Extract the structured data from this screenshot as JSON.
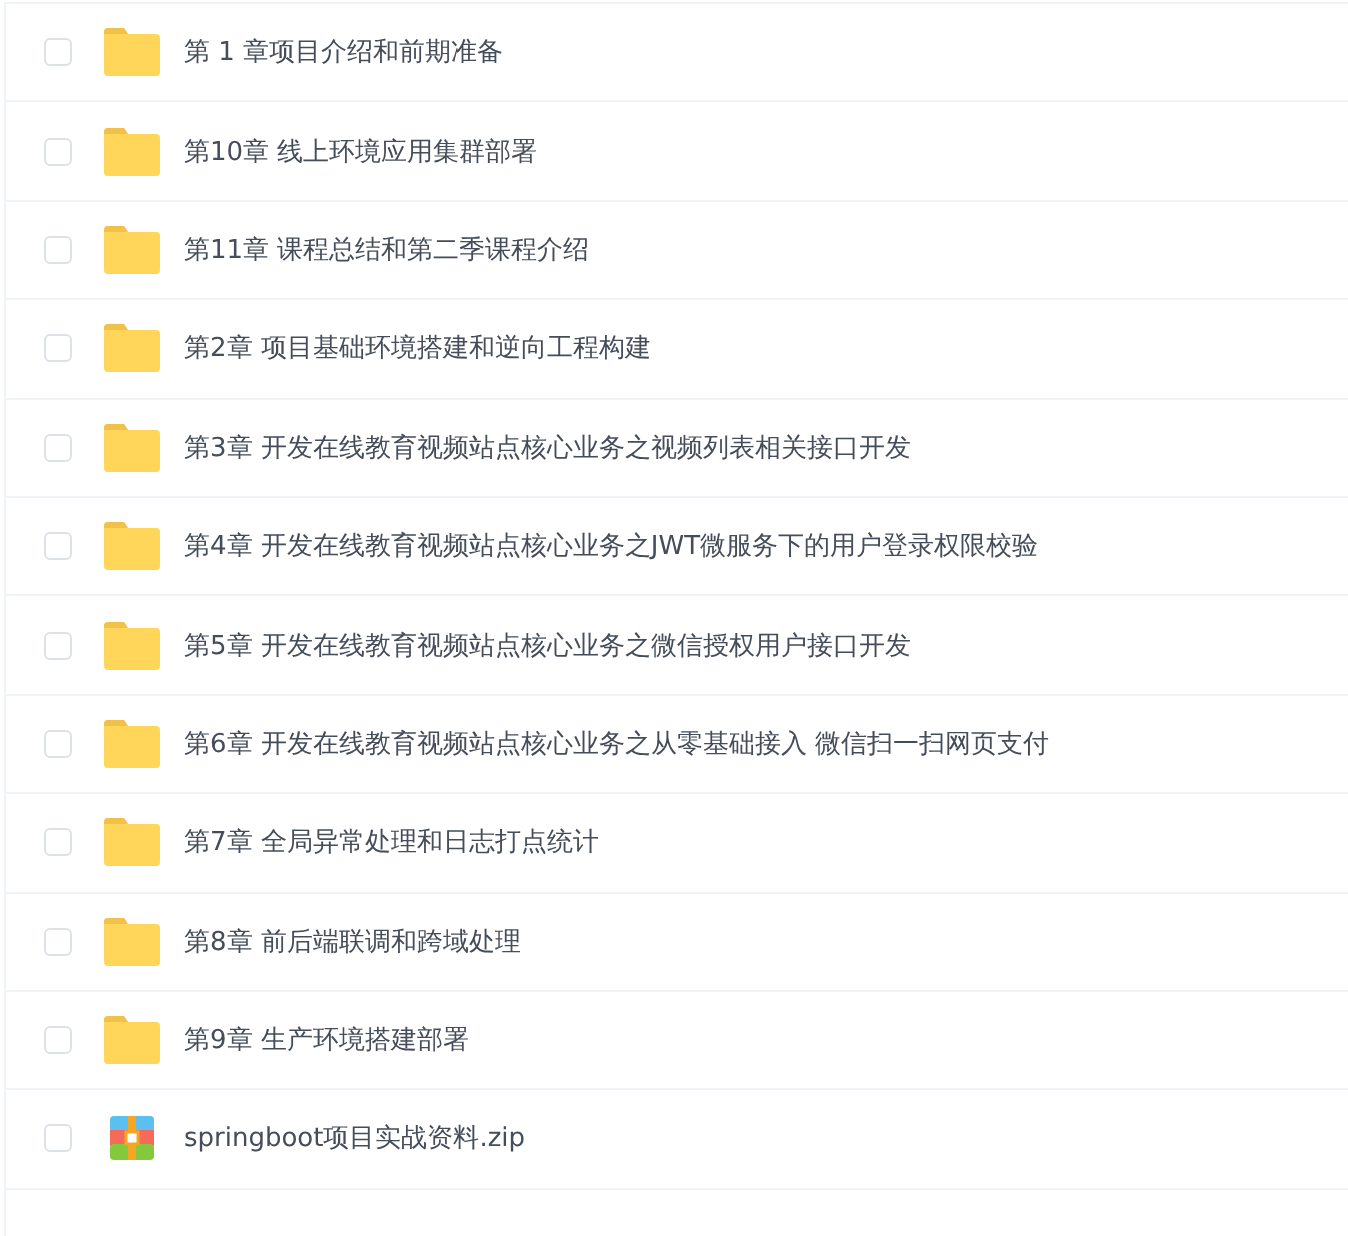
{
  "files": [
    {
      "kind": "folder",
      "name": "第 1 章项目介绍和前期准备",
      "checked": false
    },
    {
      "kind": "folder",
      "name": "第10章 线上环境应用集群部署",
      "checked": false
    },
    {
      "kind": "folder",
      "name": "第11章 课程总结和第二季课程介绍",
      "checked": false
    },
    {
      "kind": "folder",
      "name": "第2章 项目基础环境搭建和逆向工程构建",
      "checked": false
    },
    {
      "kind": "folder",
      "name": "第3章 开发在线教育视频站点核心业务之视频列表相关接口开发",
      "checked": false
    },
    {
      "kind": "folder",
      "name": "第4章 开发在线教育视频站点核心业务之JWT微服务下的用户登录权限校验",
      "checked": false
    },
    {
      "kind": "folder",
      "name": "第5章 开发在线教育视频站点核心业务之微信授权用户接口开发",
      "checked": false
    },
    {
      "kind": "folder",
      "name": "第6章 开发在线教育视频站点核心业务之从零基础接入 微信扫一扫网页支付",
      "checked": false
    },
    {
      "kind": "folder",
      "name": "第7章 全局异常处理和日志打点统计",
      "checked": false
    },
    {
      "kind": "folder",
      "name": "第8章 前后端联调和跨域处理",
      "checked": false
    },
    {
      "kind": "folder",
      "name": "第9章 生产环境搭建部署",
      "checked": false
    },
    {
      "kind": "zip",
      "name": "springboot项目实战资料.zip",
      "checked": false
    }
  ]
}
